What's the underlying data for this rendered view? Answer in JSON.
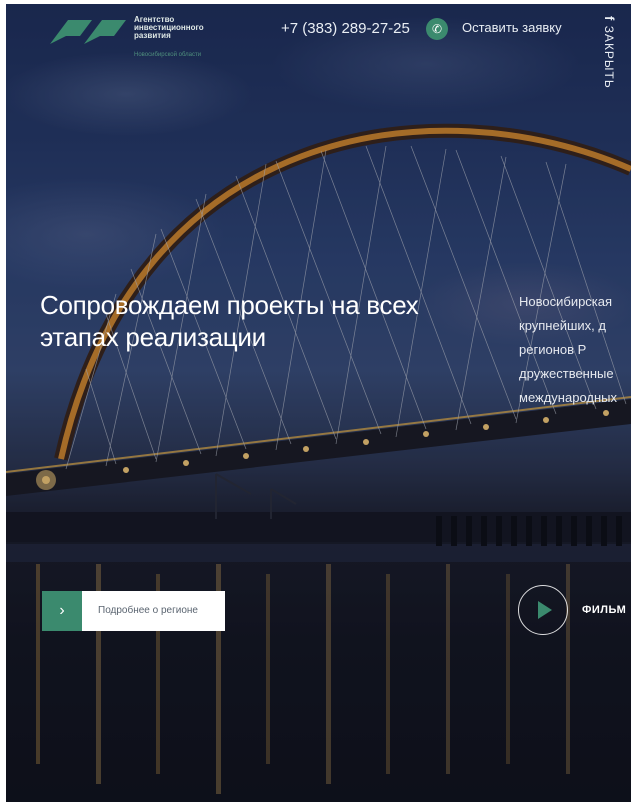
{
  "header": {
    "logo_text": "Агентство инвестиционного развития",
    "logo_sub": "Новосибирской области",
    "phone": "+7 (383) 289-27-25",
    "call_icon": "phone-icon",
    "request_label": "Оставить заявку",
    "close_label": "ЗАКРЫТЬ",
    "social_icon": "facebook-icon"
  },
  "hero": {
    "headline": "Сопровождаем проекты на всех этапах реализации",
    "side_lines": [
      "Новосибирская",
      "крупнейших, д",
      "регионов Р",
      "дружественные",
      "международных"
    ],
    "cta_label": "Подробнее о регионе",
    "cta_icon": "chevron-right-icon",
    "film_label": "ФИЛЬМ",
    "film_icon": "play-icon"
  },
  "colors": {
    "accent": "#3b8a6e",
    "sky": "#263a6a",
    "arch": "#d98b2b"
  }
}
